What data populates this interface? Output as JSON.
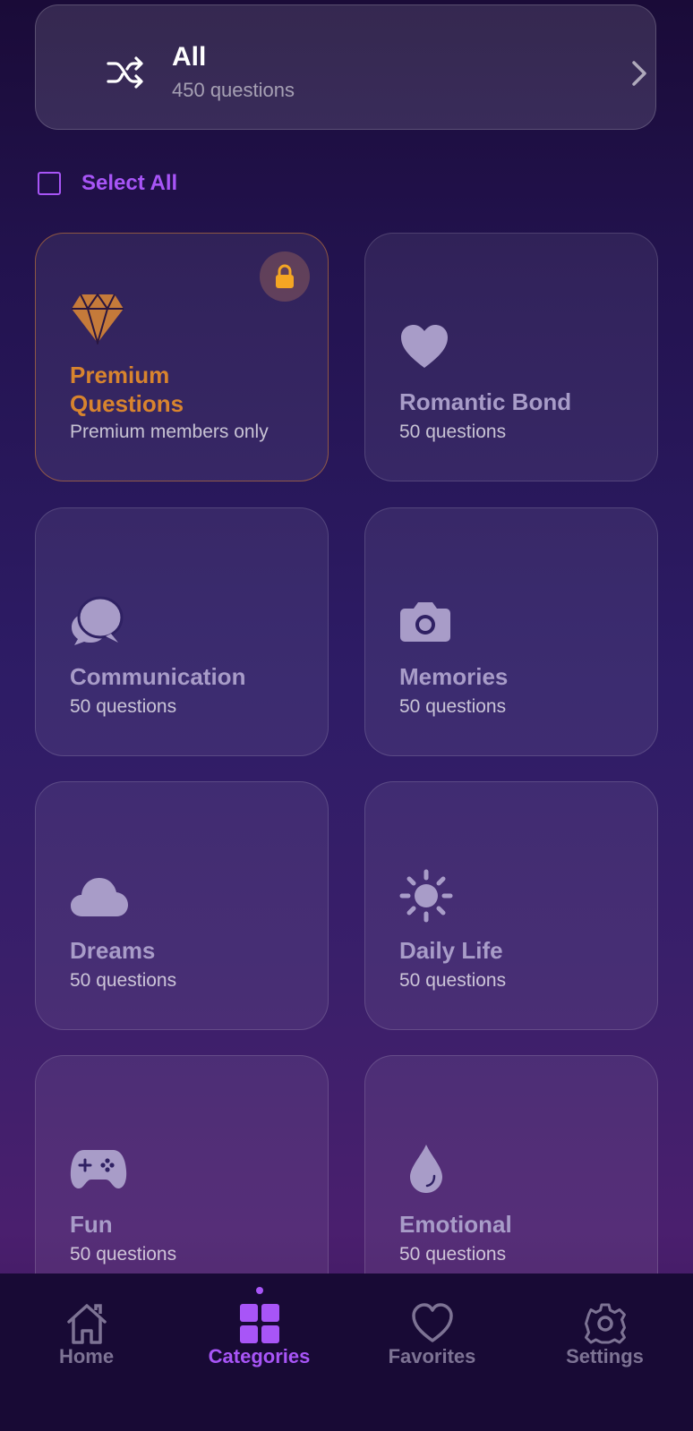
{
  "all": {
    "title": "All",
    "subtitle": "450 questions"
  },
  "select_all": {
    "label": "Select All",
    "checked": false
  },
  "categories": [
    {
      "name_line1": "Premium",
      "name_line2": "Questions",
      "subtitle": "Premium members only",
      "icon": "diamond-icon",
      "locked": true
    },
    {
      "name": "Romantic Bond",
      "subtitle": "50 questions",
      "icon": "heart-icon"
    },
    {
      "name": "Communication",
      "subtitle": "50 questions",
      "icon": "chat-bubbles-icon"
    },
    {
      "name": "Memories",
      "subtitle": "50 questions",
      "icon": "camera-icon"
    },
    {
      "name": "Dreams",
      "subtitle": "50 questions",
      "icon": "cloud-icon"
    },
    {
      "name": "Daily Life",
      "subtitle": "50 questions",
      "icon": "sun-icon"
    },
    {
      "name": "Fun",
      "subtitle": "50 questions",
      "icon": "gamepad-icon"
    },
    {
      "name": "Emotional",
      "subtitle": "50 questions",
      "icon": "drop-icon"
    }
  ],
  "nav": [
    {
      "label": "Home",
      "icon": "home-icon"
    },
    {
      "label": "Categories",
      "icon": "grid-icon",
      "active": true
    },
    {
      "label": "Favorites",
      "icon": "heart-outline-icon"
    },
    {
      "label": "Settings",
      "icon": "gear-icon"
    }
  ],
  "colors": {
    "accent": "#a855f7",
    "premium": "#d8842e",
    "lock": "#f5a623",
    "icon_muted": "#a89cc8"
  }
}
